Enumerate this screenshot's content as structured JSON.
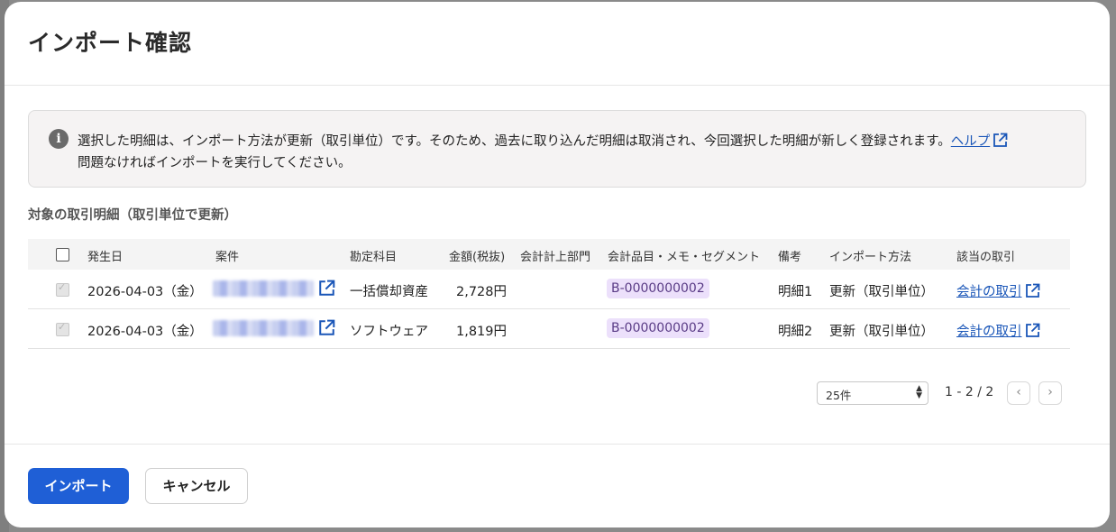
{
  "dialog": {
    "title": "インポート確認",
    "notice": {
      "line1": "選択した明細は、インポート方法が更新（取引単位）です。そのため、過去に取り込んだ明細は取消され、今回選択した明細が新しく登録されます。",
      "help_link": "ヘルプ",
      "line2": "問題なければインポートを実行してください。"
    },
    "section_title": "対象の取引明細（取引単位で更新）",
    "table": {
      "columns": [
        "発生日",
        "案件",
        "勘定科目",
        "金額(税抜)",
        "会計計上部門",
        "会計品目・メモ・セグメント",
        "備考",
        "インポート方法",
        "該当の取引"
      ],
      "rows": [
        {
          "date": "2026-04-03（金）",
          "account": "一括償却資産",
          "amount": "2,728円",
          "dept": "",
          "segment": "B-0000000002",
          "memo": "明細1",
          "method": "更新（取引単位）",
          "link": "会計の取引"
        },
        {
          "date": "2026-04-03（金）",
          "account": "ソフトウェア",
          "amount": "1,819円",
          "dept": "",
          "segment": "B-0000000002",
          "memo": "明細2",
          "method": "更新（取引単位）",
          "link": "会計の取引"
        }
      ]
    },
    "pagination": {
      "per_page": "25件",
      "range": "1 - 2 / 2"
    },
    "footer": {
      "import_label": "インポート",
      "cancel_label": "キャンセル"
    }
  },
  "colors": {
    "primary": "#1f5fd6",
    "link": "#1a56b8",
    "badge_bg": "#ece0fb"
  }
}
